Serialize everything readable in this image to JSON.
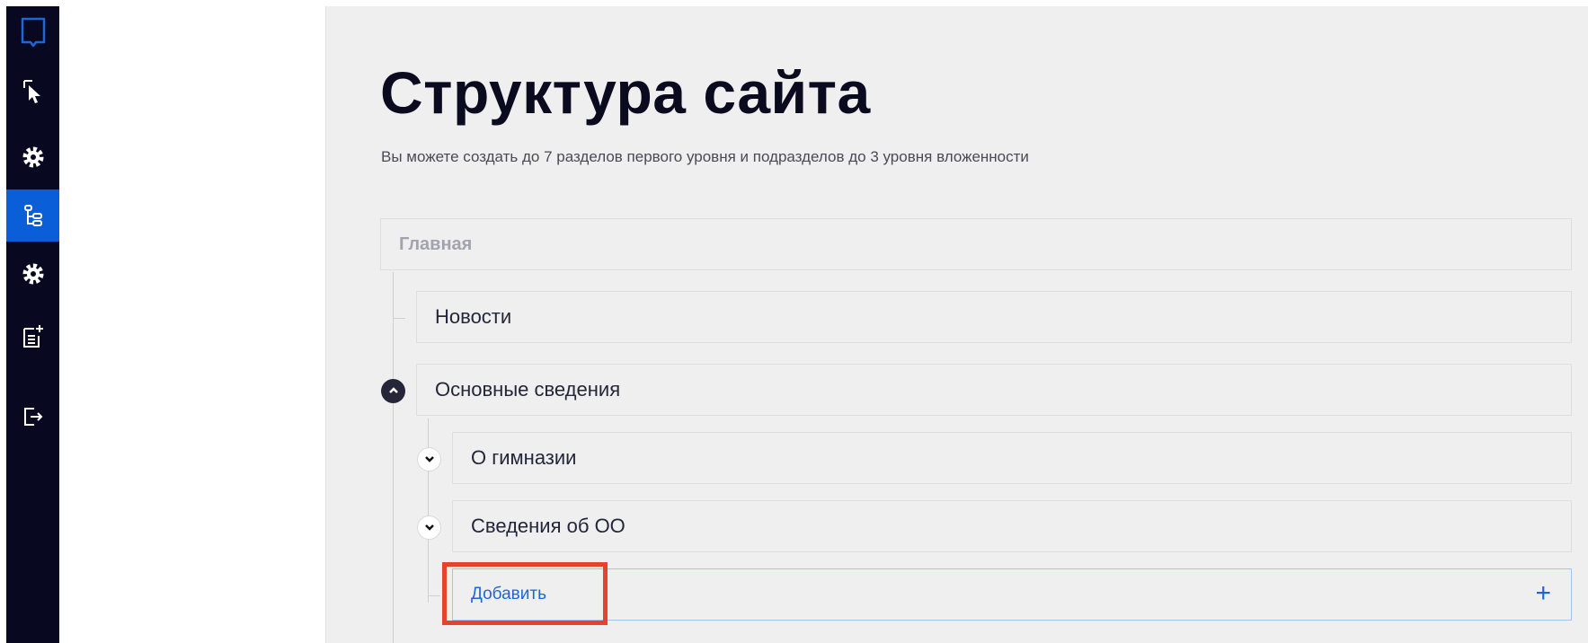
{
  "sidebar": {
    "items": [
      {
        "icon": "bookmark-icon",
        "active": false
      },
      {
        "icon": "cursor-select-icon",
        "active": false
      },
      {
        "icon": "gear-icon",
        "active": false
      },
      {
        "icon": "site-tree-icon",
        "active": true
      },
      {
        "icon": "gear-icon",
        "active": false
      },
      {
        "icon": "add-document-icon",
        "active": false
      },
      {
        "icon": "logout-icon",
        "active": false
      }
    ],
    "colors": {
      "background": "#080821",
      "active": "#0a5ed7",
      "icon": "#ffffff"
    }
  },
  "main": {
    "title": "Структура сайта",
    "subtitle": "Вы можете создать до 7 разделов первого уровня и подразделов до 3 уровня вложенности",
    "tree": {
      "root": "Главная",
      "level1": [
        "Новости",
        "Основные сведения"
      ],
      "level2": [
        "О гимназии",
        "Сведения об ОО"
      ],
      "add_label": "Добавить",
      "add_icon": "+"
    }
  },
  "colors": {
    "accent": "#1f66d4",
    "highlight": "#e5432b",
    "title": "#0b0b1f",
    "content_bg": "#efefef"
  }
}
